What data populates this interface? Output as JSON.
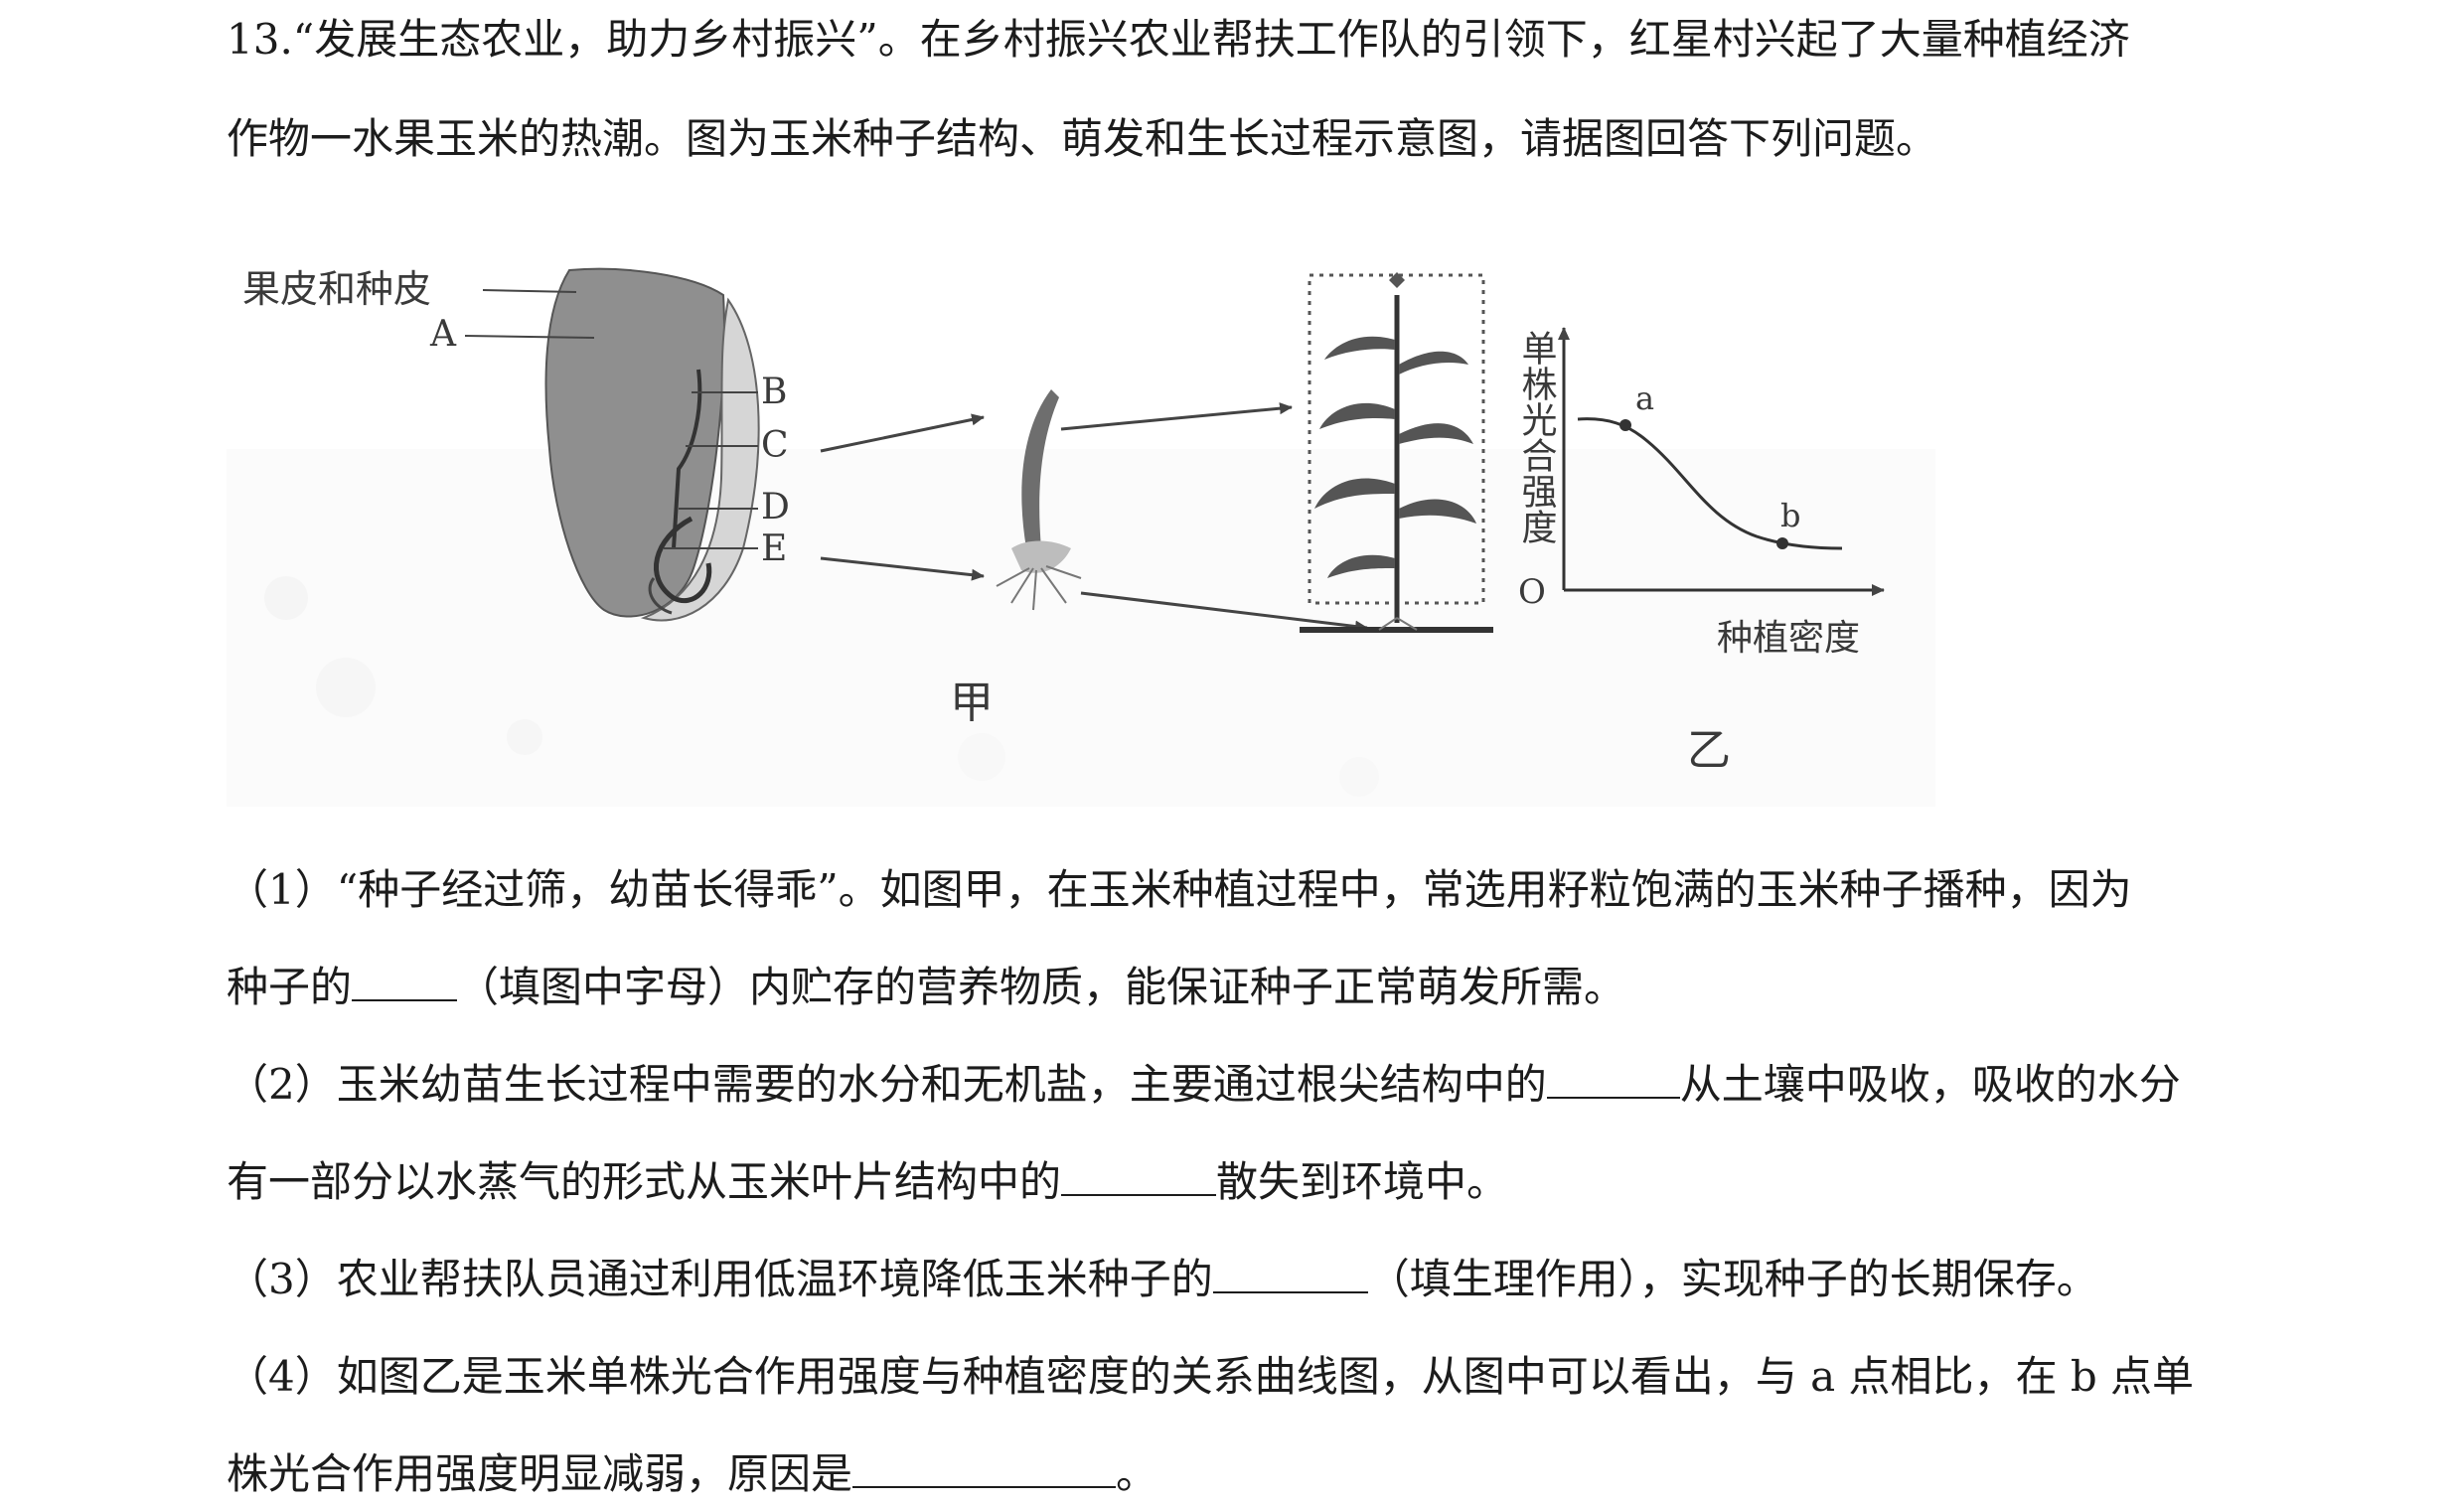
{
  "question": {
    "number": "13.",
    "stem_line1": "“发展生态农业，助力乡村振兴”。在乡村振兴农业帮扶工作队的引领下，红星村兴起了大量种植经济",
    "stem_line2": "作物一水果玉米的热潮。图为玉米种子结构、萌发和生长过程示意图，请据图回答下列问题。"
  },
  "figure": {
    "seed_labels": {
      "pericarp": "果皮和种皮",
      "A": "A",
      "B": "B",
      "C": "C",
      "D": "D",
      "E": "E"
    },
    "caption_jia": "甲",
    "caption_yi": "乙",
    "graph": {
      "ylabel": "单株光合强度",
      "xlabel": "种植密度",
      "origin": "O",
      "point_a": "a",
      "point_b": "b"
    }
  },
  "subquestions": {
    "q1_line1": "（1）“种子经过筛，幼苗长得乖”。如图甲，在玉米种植过程中，常选用籽粒饱满的玉米种子播种，因为",
    "q1_line2_a": "种子的",
    "q1_line2_b": "（填图中字母）内贮存的营养物质，能保证种子正常萌发所需。",
    "q2_line1_a": "（2）玉米幼苗生长过程中需要的水分和无机盐，主要通过根尖结构中的",
    "q2_line1_b": "从土壤中吸收，吸收的水分",
    "q2_line2_a": "有一部分以水蒸气的形式从玉米叶片结构中的",
    "q2_line2_b": "散失到环境中。",
    "q3_a": "（3）农业帮扶队员通过利用低温环境降低玉米种子的",
    "q3_b": "（填生理作用），实现种子的长期保存。",
    "q4_line1": "（4）如图乙是玉米单株光合作用强度与种植密度的关系曲线图，从图中可以看出，与 a 点相比，在 b 点单",
    "q4_line2_a": "株光合作用强度明显减弱，原因是",
    "q4_line2_b": "。"
  }
}
